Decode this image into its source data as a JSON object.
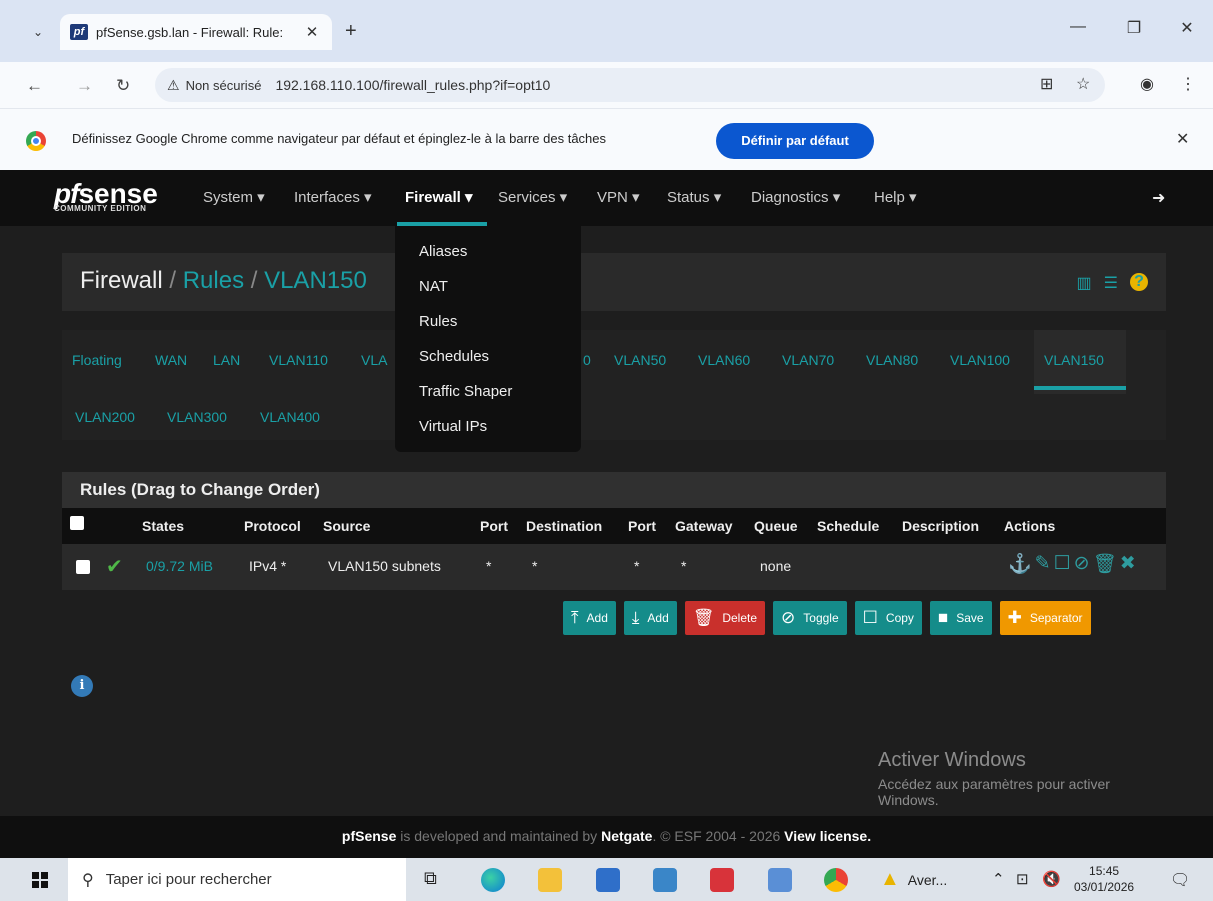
{
  "browser": {
    "tab_title": "pfSense.gsb.lan - Firewall: Rule:",
    "favicon_text": "pf",
    "security_label": "Non sécurisé",
    "url": "192.168.110.100/firewall_rules.php?if=opt10",
    "infobar_text": "Définissez Google Chrome comme navigateur par défaut et épinglez-le à la barre des tâches",
    "infobar_button": "Définir par défaut"
  },
  "nav": {
    "logo_pf": "pf",
    "logo_sense": "sense",
    "logo_edition": "COMMUNITY EDITION",
    "items": [
      {
        "label": "System ▾"
      },
      {
        "label": "Interfaces ▾"
      },
      {
        "label": "Firewall ▾"
      },
      {
        "label": "Services ▾"
      },
      {
        "label": "VPN ▾"
      },
      {
        "label": "Status ▾"
      },
      {
        "label": "Diagnostics ▾"
      },
      {
        "label": "Help ▾"
      }
    ],
    "active": "Firewall"
  },
  "dropdown": {
    "items": [
      "Aliases",
      "NAT",
      "Rules",
      "Schedules",
      "Traffic Shaper",
      "Virtual IPs"
    ]
  },
  "breadcrumb": {
    "root": "Firewall",
    "sep": " / ",
    "rules": "Rules",
    "iface": "VLAN150"
  },
  "iface_tabs": {
    "row1": [
      "Floating",
      "WAN",
      "LAN",
      "VLAN110",
      "VLA",
      "0",
      "VLAN50",
      "VLAN60",
      "VLAN70",
      "VLAN80",
      "VLAN100",
      "VLAN150"
    ],
    "row2": [
      "VLAN200",
      "VLAN300",
      "VLAN400"
    ],
    "active": "VLAN150"
  },
  "rules": {
    "title": "Rules (Drag to Change Order)",
    "columns": [
      "States",
      "Protocol",
      "Source",
      "Port",
      "Destination",
      "Port",
      "Gateway",
      "Queue",
      "Schedule",
      "Description",
      "Actions"
    ],
    "row": {
      "states": "0/9.72 MiB",
      "protocol": "IPv4 *",
      "source": "VLAN150 subnets",
      "port": "*",
      "destination": "*",
      "dest_port": "*",
      "gateway": "*",
      "queue": "none",
      "schedule": "",
      "description": ""
    }
  },
  "buttons": {
    "add_top": "Add",
    "add_bottom": "Add",
    "delete": "Delete",
    "toggle": "Toggle",
    "copy": "Copy",
    "save": "Save",
    "separator": "Separator"
  },
  "watermark": {
    "line1": "Activer Windows",
    "line2": "Accédez aux paramètres pour activer",
    "line3": "Windows."
  },
  "footer": {
    "brand": "pfSense",
    "mid": " is developed and maintained by ",
    "company": "Netgate",
    "copy": ". © ESF 2004 - 2026 ",
    "license": "View license."
  },
  "taskbar": {
    "search_placeholder": "Taper ici pour rechercher",
    "aver_label": "Aver...",
    "time": "15:45",
    "date": "03/01/2026"
  },
  "colors": {
    "accent": "#1aa0a6",
    "navbar": "#0f0f0f",
    "page_bg": "#1e1e1e"
  }
}
